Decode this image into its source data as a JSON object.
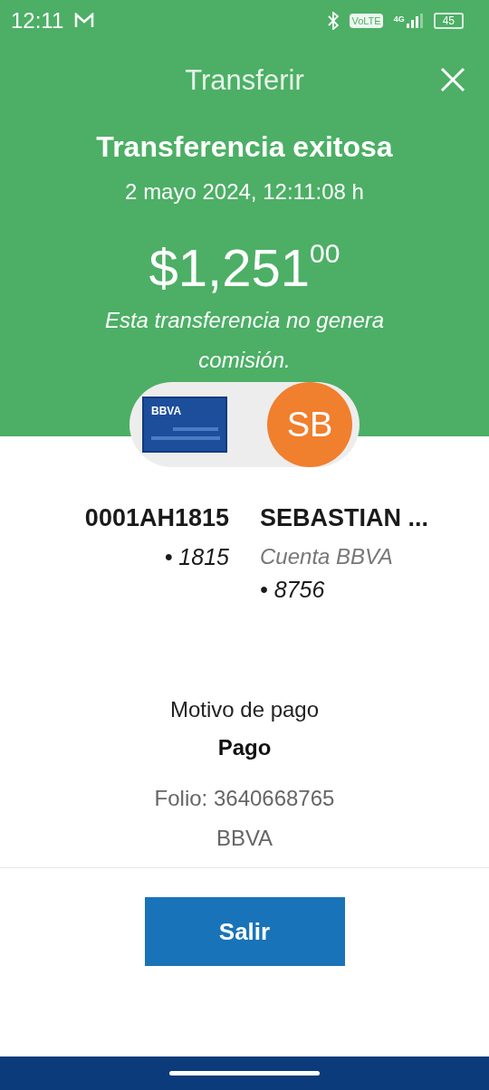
{
  "status_bar": {
    "time": "12:11",
    "volte": "VoLTE",
    "network": "4G",
    "battery": "45"
  },
  "header": {
    "title": "Transferir"
  },
  "result": {
    "title": "Transferencia exitosa",
    "datetime": "2 mayo 2024, 12:11:08 h",
    "amount": "$1,251",
    "cents": "00",
    "note": "Esta transferencia no genera comisión."
  },
  "origin": {
    "card_brand": "BBVA",
    "name": "0001AH1815",
    "account": "• 1815"
  },
  "destination": {
    "initials": "SB",
    "name": "SEBASTIAN ...",
    "bank": "Cuenta BBVA",
    "account": "• 8756"
  },
  "details": {
    "reason_label": "Motivo de pago",
    "reason": "Pago",
    "folio": "Folio: 3640668765",
    "bank": "BBVA"
  },
  "button": "Salir"
}
